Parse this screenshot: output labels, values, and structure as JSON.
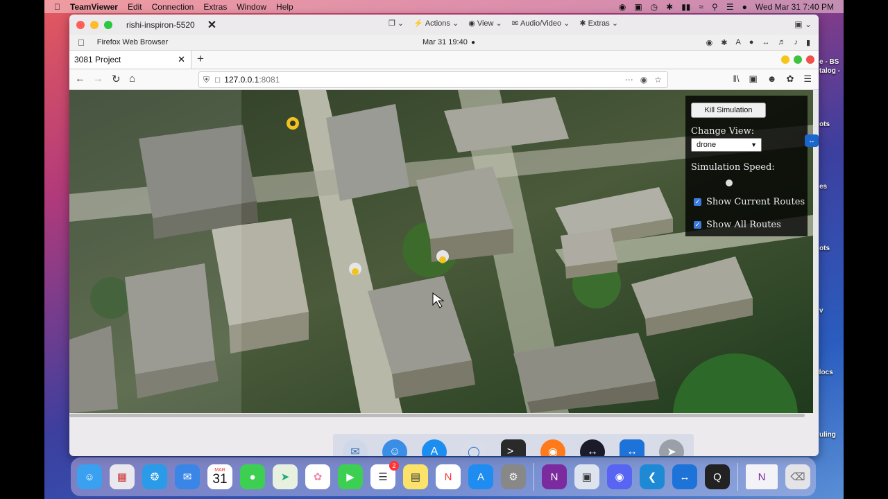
{
  "menubar": {
    "app": "TeamViewer",
    "items": [
      "Edit",
      "Connection",
      "Extras",
      "Window",
      "Help"
    ],
    "datetime": "Wed Mar 31  7:40 PM"
  },
  "teamviewer": {
    "session_name": "rishi-inspiron-5520",
    "toolbar": [
      "Actions",
      "View",
      "Audio/Video",
      "Extras"
    ]
  },
  "remote_menubar": {
    "app": "Firefox Web Browser",
    "clock": "Mar 31  19:40"
  },
  "firefox": {
    "tab_title": "3081 Project",
    "url_host": "127.0.0.1",
    "url_port": ":8081"
  },
  "panel": {
    "kill_button": "Kill Simulation",
    "change_view_label": "Change View:",
    "view_value": "drone",
    "speed_label": "Simulation Speed:",
    "speed_value": 0.5,
    "show_current_routes": "Show Current Routes",
    "show_all_routes": "Show All Routes",
    "current_checked": true,
    "all_checked": true
  },
  "desktop_labels": [
    "e - BS",
    "talog -",
    "ots",
    "es",
    "ots",
    "v",
    "y docs",
    "uling"
  ],
  "calendar": {
    "month": "MAR",
    "day": "31"
  },
  "reminders_badge": "2"
}
